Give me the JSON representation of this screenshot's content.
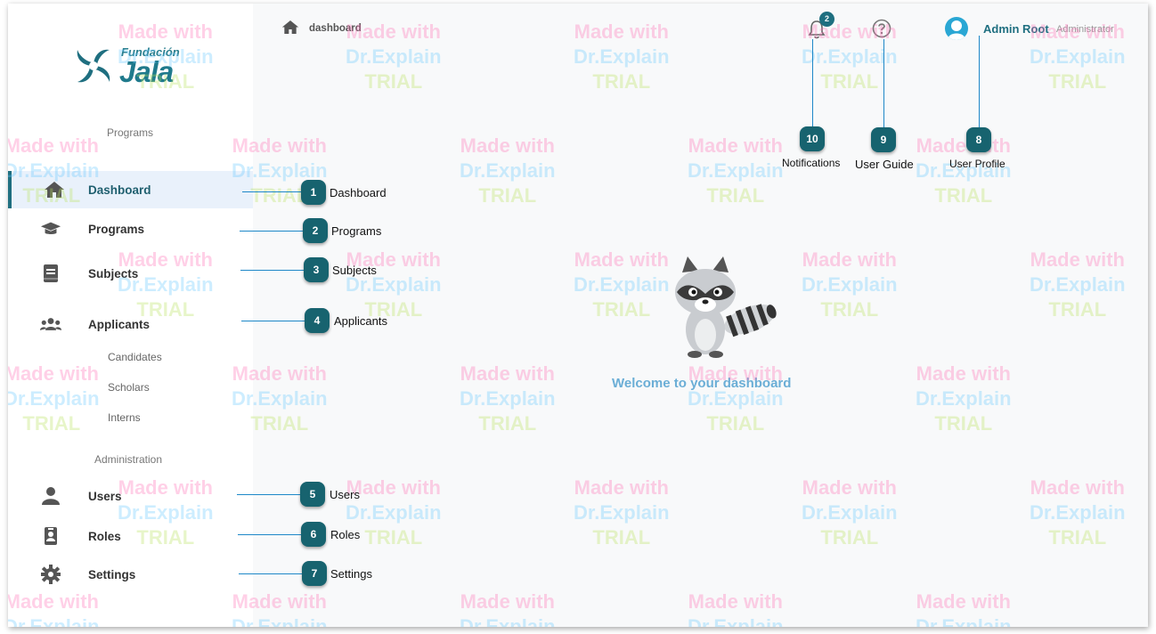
{
  "sidebar": {
    "logo": {
      "small": "Fundación",
      "big": "Jala"
    },
    "programs_section_title": "Programs",
    "items": [
      {
        "label": "Dashboard",
        "icon": "home-icon",
        "active": true
      },
      {
        "label": "Programs",
        "icon": "graduation-cap-icon"
      },
      {
        "label": "Subjects",
        "icon": "book-icon"
      },
      {
        "label": "Applicants",
        "icon": "users-group-icon"
      }
    ],
    "sub_items": [
      "Candidates",
      "Scholars",
      "Interns"
    ],
    "administration_section_title": "Administration",
    "admin_items": [
      {
        "label": "Users",
        "icon": "user-icon"
      },
      {
        "label": "Roles",
        "icon": "id-badge-icon"
      },
      {
        "label": "Settings",
        "icon": "gear-icon"
      }
    ]
  },
  "header": {
    "breadcrumb": "dashboard",
    "notification_count": "2",
    "user_name": "Admin Root",
    "user_role": "Administrator"
  },
  "main": {
    "welcome": "Welcome to your dashboard"
  },
  "callouts": [
    {
      "number": "1",
      "label": "Dashboard"
    },
    {
      "number": "2",
      "label": "Programs"
    },
    {
      "number": "3",
      "label": "Subjects"
    },
    {
      "number": "4",
      "label": "Applicants"
    },
    {
      "number": "5",
      "label": "Users"
    },
    {
      "number": "6",
      "label": "Roles"
    },
    {
      "number": "7",
      "label": "Settings"
    },
    {
      "number": "8",
      "label": "User Profile"
    },
    {
      "number": "9",
      "label": "User Guide"
    },
    {
      "number": "10",
      "label": "Notifications"
    }
  ],
  "watermark": {
    "line1": "Made with",
    "line2": "Dr.Explain",
    "line3": "TRIAL"
  },
  "colors": {
    "accent": "#1f6f80",
    "callout": "#17636f",
    "leader_line": "#1e88c8",
    "welcome": "#6baed6"
  }
}
